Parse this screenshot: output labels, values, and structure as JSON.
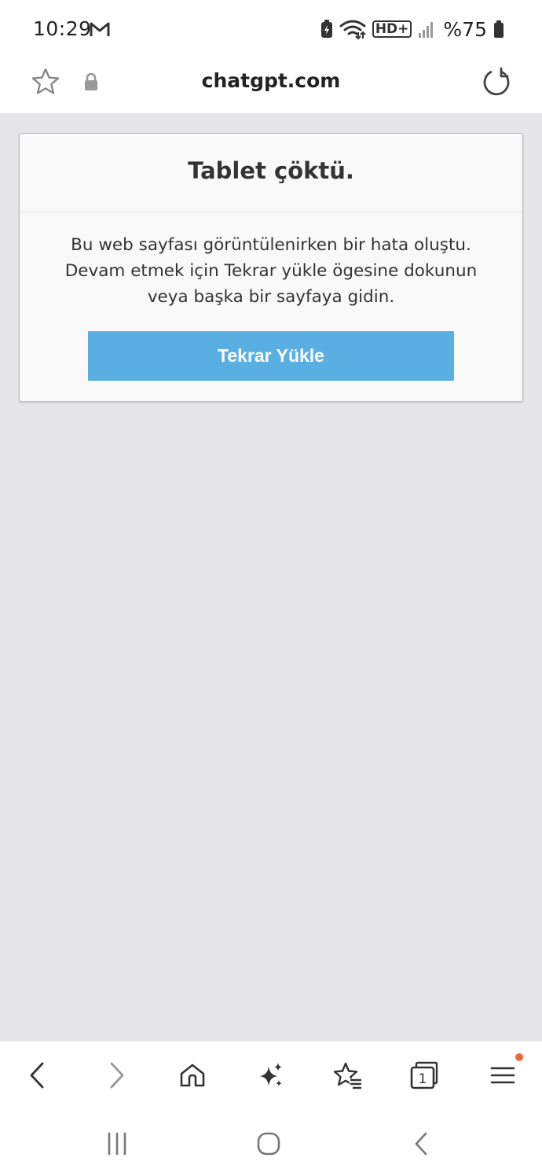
{
  "status_bar": {
    "time": "10:29",
    "notification_icon": "gmail-icon",
    "battery_percent": "%75",
    "network_label": "HD+",
    "icons": [
      "battery-saver-icon",
      "wifi-icon",
      "hd-plus-icon",
      "signal-icon",
      "battery-icon"
    ]
  },
  "url_bar": {
    "url": "chatgpt.com",
    "star_icon": "star-icon",
    "lock_icon": "lock-icon",
    "reload_icon": "reload-icon"
  },
  "error_card": {
    "title": "Tablet çöktü.",
    "message": "Bu web sayfası görüntülenirken bir hata oluştu. Devam etmek için Tekrar yükle ögesine dokunun veya başka bir sayfaya gidin.",
    "button_label": "Tekrar Yükle",
    "button_color": "#5aafe2"
  },
  "toolbar": {
    "items": [
      "back-icon",
      "forward-icon",
      "home-icon",
      "sparkle-icon",
      "bookmarks-icon",
      "tabs-icon",
      "menu-icon"
    ],
    "tab_count": "1",
    "menu_badge_color": "#e8693a"
  },
  "system_nav": {
    "items": [
      "recents-icon",
      "home-circle-icon",
      "system-back-icon"
    ]
  },
  "colors": {
    "content_background": "#e6e6e8",
    "card_background": "#f9f9f9"
  }
}
